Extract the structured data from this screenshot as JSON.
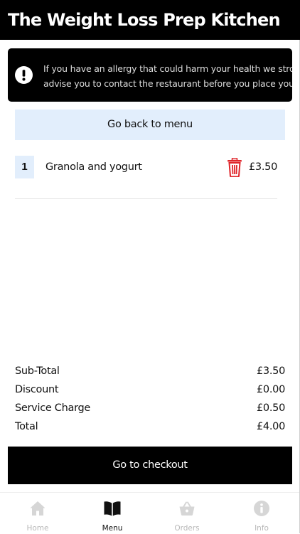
{
  "header": {
    "title": "The Weight Loss Prep Kitchen"
  },
  "allergy_notice": {
    "icon": "exclamation-circle-icon",
    "line1": "If you have an allergy that could harm your health we strongly",
    "line2": "advise you to contact the restaurant before you place your order"
  },
  "back_button": {
    "label": "Go back to menu"
  },
  "basket": {
    "items": [
      {
        "quantity": "1",
        "name": "Granola and yogurt",
        "price": "£3.50",
        "delete_icon": "trash-icon"
      }
    ]
  },
  "totals": {
    "subtotal_label": "Sub-Total",
    "subtotal_value": "£3.50",
    "discount_label": "Discount",
    "discount_value": "£0.00",
    "service_label": "Service Charge",
    "service_value": "£0.50",
    "total_label": "Total",
    "total_value": "£4.00"
  },
  "checkout_button": {
    "label": "Go to checkout"
  },
  "tabs": [
    {
      "label": "Home",
      "icon": "home-icon",
      "active": false
    },
    {
      "label": "Menu",
      "icon": "book-icon",
      "active": true
    },
    {
      "label": "Orders",
      "icon": "basket-icon",
      "active": false
    },
    {
      "label": "Info",
      "icon": "info-icon",
      "active": false
    }
  ],
  "colors": {
    "header_bg": "#000000",
    "button_light": "#e2eefc",
    "delete_red": "#e0262b",
    "inactive_tab": "#b8b8b8"
  }
}
